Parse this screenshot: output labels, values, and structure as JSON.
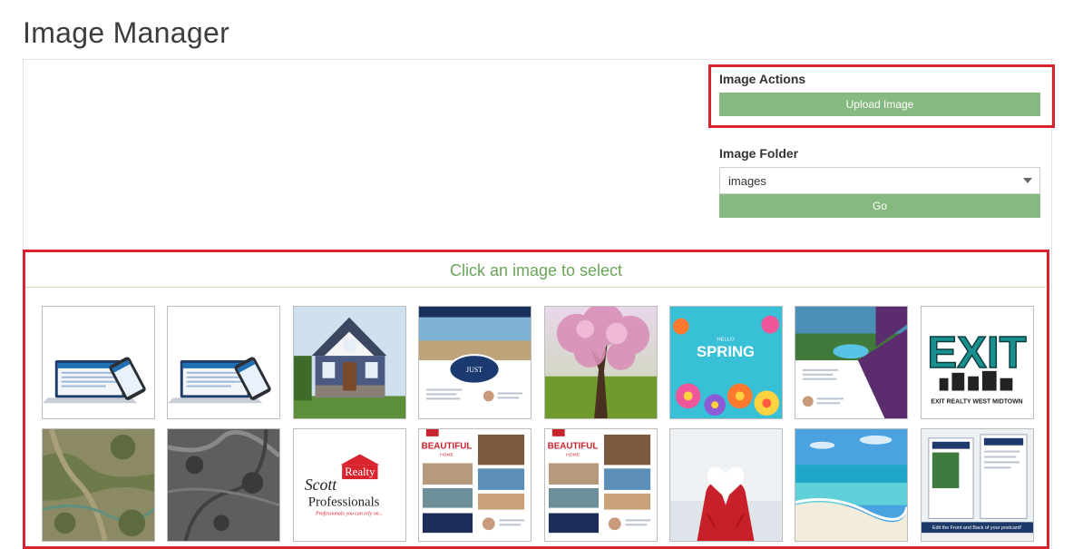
{
  "page": {
    "title": "Image Manager"
  },
  "actions": {
    "heading": "Image Actions",
    "upload_label": "Upload Image"
  },
  "folder": {
    "heading": "Image Folder",
    "selected": "images",
    "go_label": "Go"
  },
  "gallery": {
    "instruction": "Click an image to select",
    "images": [
      {
        "name": "laptop-phone-mockup-1",
        "kind": "laptop"
      },
      {
        "name": "laptop-phone-mockup-2",
        "kind": "laptop"
      },
      {
        "name": "blue-house",
        "kind": "house"
      },
      {
        "name": "just-listed-flyer",
        "kind": "flyer",
        "text": "JUST"
      },
      {
        "name": "blossom-tree",
        "kind": "tree"
      },
      {
        "name": "hello-spring",
        "kind": "spring",
        "small_text": "HELLO",
        "text": "SPRING"
      },
      {
        "name": "luxury-property-flyer",
        "kind": "villa"
      },
      {
        "name": "exit-realty-logo",
        "kind": "exit",
        "text": "EXIT",
        "caption": "EXIT REALTY WEST MIDTOWN"
      },
      {
        "name": "aerial-map-color",
        "kind": "aerial"
      },
      {
        "name": "aerial-map-grey",
        "kind": "aerial-grey"
      },
      {
        "name": "scott-realty-logo",
        "kind": "scott",
        "text_scott": "Scott",
        "text_realty": "Realty",
        "text_prof": "Professionals",
        "tagline": "Professionals you can rely on..."
      },
      {
        "name": "beautiful-home-flyer-1",
        "kind": "beautiful",
        "text": "BEAUTIFUL",
        "sub": "HOME"
      },
      {
        "name": "beautiful-home-flyer-2",
        "kind": "beautiful",
        "text": "BEAUTIFUL",
        "sub": "HOME"
      },
      {
        "name": "snow-heart-mittens",
        "kind": "heart"
      },
      {
        "name": "tropical-beach",
        "kind": "beach"
      },
      {
        "name": "postcard-mockup",
        "kind": "postcard",
        "caption": "Edit the Front and Back of your postcard!"
      }
    ]
  }
}
